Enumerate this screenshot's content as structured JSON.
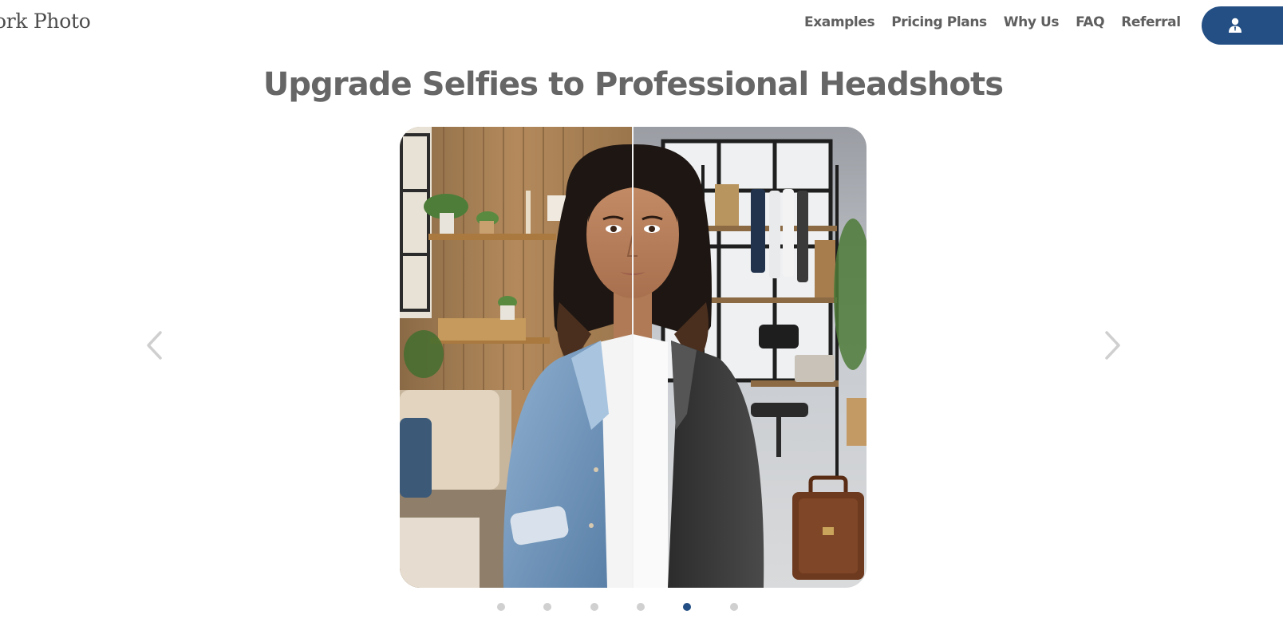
{
  "header": {
    "logo_text": "ork Photo",
    "nav": [
      {
        "label": "Examples"
      },
      {
        "label": "Pricing Plans"
      },
      {
        "label": "Why Us"
      },
      {
        "label": "FAQ"
      },
      {
        "label": "Referral"
      }
    ],
    "account_icon": "user-icon"
  },
  "hero": {
    "headline": "Upgrade Selfies to Professional Headshots"
  },
  "carousel": {
    "prev_icon": "chevron-left-icon",
    "next_icon": "chevron-right-icon",
    "slide_count": 6,
    "active_index": 4,
    "slide_description_icon": "before-after-portrait-image"
  },
  "colors": {
    "brand": "#244f84",
    "text": "#666666",
    "nav_text": "#5f5f5f",
    "dot_inactive": "#d0d0d0"
  }
}
